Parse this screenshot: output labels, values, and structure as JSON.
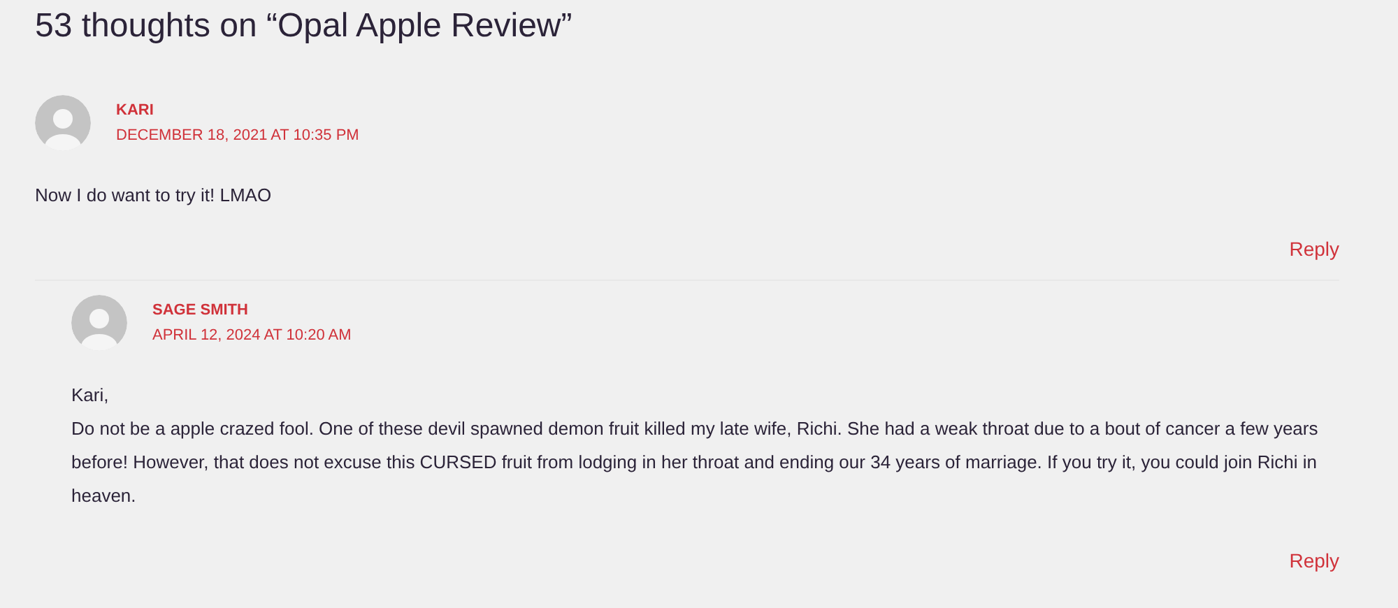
{
  "title": "53 thoughts on “Opal Apple Review”",
  "comments": [
    {
      "author": "KARI",
      "date": "DECEMBER 18, 2021 AT 10:35 PM",
      "body": [
        "Now I do want to try it! LMAO"
      ],
      "reply": "Reply",
      "children": [
        {
          "author": "SAGE SMITH",
          "date": "APRIL 12, 2024 AT 10:20 AM",
          "body": [
            "Kari,",
            "Do not be a apple crazed fool. One of these devil spawned demon fruit killed my late wife, Richi. She had a weak throat due to a bout of cancer a few years before! However, that does not excuse this CURSED fruit from lodging in her throat and ending our 34 years of marriage. If you try it, you could join Richi in heaven."
          ],
          "reply": "Reply"
        }
      ]
    }
  ]
}
